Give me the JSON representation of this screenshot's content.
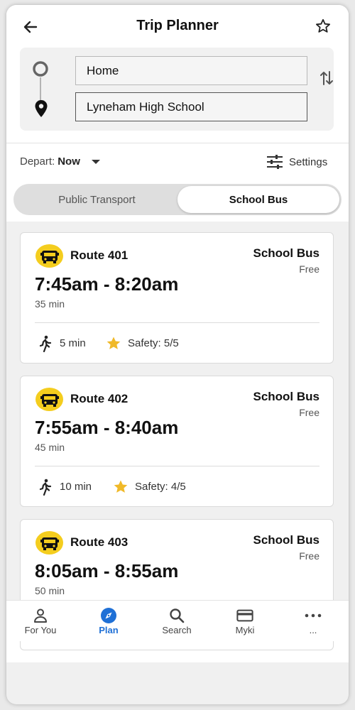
{
  "header": {
    "title": "Trip Planner",
    "back_icon": "arrow-left-icon",
    "favorite_icon": "star-outline-icon"
  },
  "trip": {
    "from": "Home",
    "to": "Lyneham High School",
    "origin_icon": "origin-circle-icon",
    "destination_icon": "location-pin-icon",
    "swap_icon": "swap-vertical-icon"
  },
  "options": {
    "depart_label": "Depart:",
    "depart_value": "Now",
    "settings_label": "Settings"
  },
  "mode_toggle": {
    "options": [
      "Public Transport",
      "School Bus"
    ],
    "selected": "School Bus"
  },
  "results": [
    {
      "route": "Route 401",
      "mode": "School Bus",
      "fare": "Free",
      "times": "7:45am - 8:20am",
      "duration": "35 min",
      "walk": "5 min",
      "safety": "Safety: 5/5"
    },
    {
      "route": "Route 402",
      "mode": "School Bus",
      "fare": "Free",
      "times": "7:55am - 8:40am",
      "duration": "45 min",
      "walk": "10 min",
      "safety": "Safety: 4/5"
    },
    {
      "route": "Route 403",
      "mode": "School Bus",
      "fare": "Free",
      "times": "8:05am - 8:55am",
      "duration": "50 min"
    }
  ],
  "bottom_nav": {
    "items": [
      {
        "label": "For You",
        "icon": "person-icon"
      },
      {
        "label": "Plan",
        "icon": "compass-icon"
      },
      {
        "label": "Search",
        "icon": "search-icon"
      },
      {
        "label": "Myki",
        "icon": "card-icon"
      },
      {
        "label": "...",
        "icon": "more-icon"
      }
    ],
    "active": "Plan"
  },
  "colors": {
    "accent": "#1f70d6",
    "bus_badge": "#f4cd1e",
    "star": "#f0b928"
  }
}
